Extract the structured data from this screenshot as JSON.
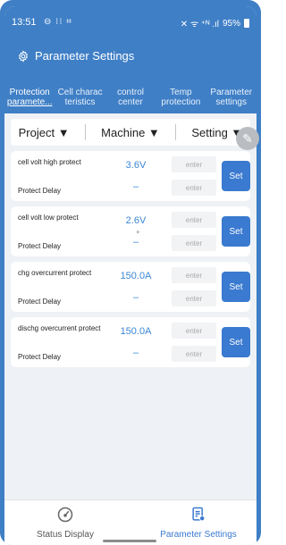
{
  "statusbar": {
    "time": "13:51",
    "left_icons": "⊖ ⁝⁝ ⌗",
    "right_icons": "✕ ᯤ ⁺ᴺ .ıl",
    "battery": "95%"
  },
  "header": {
    "title": "Parameter Settings"
  },
  "tabs": [
    {
      "line1": "Protection",
      "line2": "paramete...",
      "active": true
    },
    {
      "line1": "Cell charac",
      "line2": "teristics"
    },
    {
      "line1": "control",
      "line2": "center"
    },
    {
      "line1": "Temp",
      "line2": "protection"
    },
    {
      "line1": "Parameter",
      "line2": "settings"
    }
  ],
  "filters": [
    {
      "label": "Project ▼"
    },
    {
      "label": "Machine ▼"
    },
    {
      "label": "Setting ▼"
    }
  ],
  "cards": [
    {
      "label": "cell volt high protect",
      "value": "3.6V",
      "delay_label": "Protect Delay",
      "delay_value": "–",
      "placeholder1": "enter",
      "placeholder2": "enter",
      "set_label": "Set"
    },
    {
      "label": "cell volt low protect",
      "value": "2.6V",
      "delay_label": "Protect Delay",
      "delay_value": "–",
      "placeholder1": "enter",
      "placeholder2": "enter",
      "set_label": "Set"
    },
    {
      "label": "chg overcurrent protect",
      "value": "150.0A",
      "delay_label": "Protect Delay",
      "delay_value": "–",
      "placeholder1": "enter",
      "placeholder2": "enter",
      "set_label": "Set"
    },
    {
      "label": "dischg overcurrent protect",
      "value": "150.0A",
      "delay_label": "Protect Delay",
      "delay_value": "–",
      "placeholder1": "enter",
      "placeholder2": "enter",
      "set_label": "Set"
    }
  ],
  "bottom_nav": [
    {
      "label": "Status Display",
      "icon": "gauge-icon"
    },
    {
      "label": "Parameter Settings",
      "icon": "settings-doc-icon",
      "active": true
    }
  ],
  "colors": {
    "primary": "#3f7fc6",
    "accent": "#3a7ad0",
    "value": "#3a86d4"
  }
}
